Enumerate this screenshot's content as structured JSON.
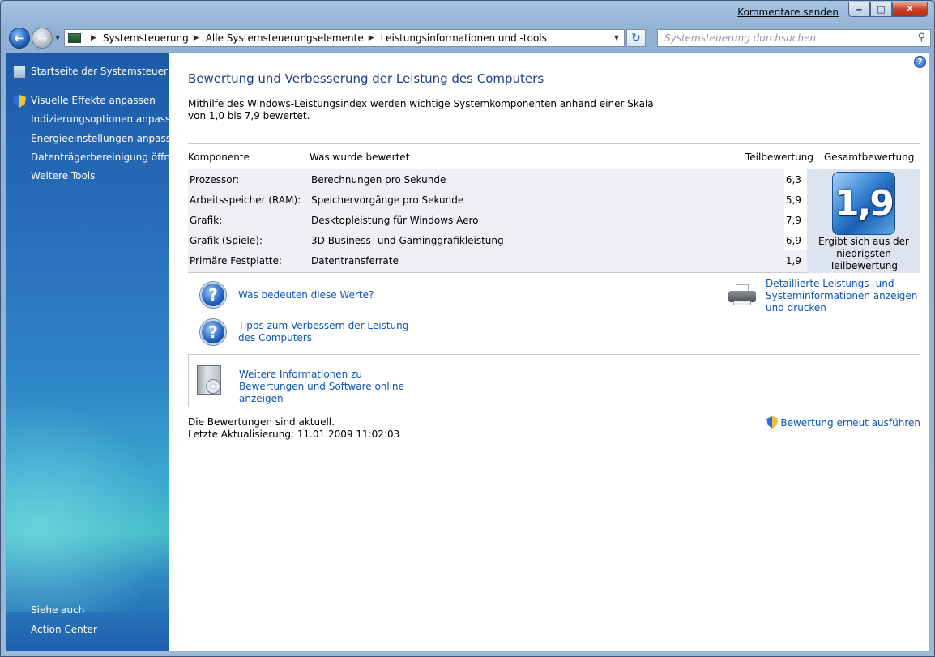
{
  "titlebar": {
    "feedback_label": "Kommentare senden",
    "minimize_icon": "minimize-icon",
    "maximize_icon": "maximize-icon",
    "close_icon": "close-icon"
  },
  "nav": {
    "back_icon": "arrow-left-icon",
    "forward_icon": "arrow-right-icon",
    "breadcrumbs": [
      "Systemsteuerung",
      "Alle Systemsteuerungselemente",
      "Leistungsinformationen und -tools"
    ],
    "search_placeholder": "Systemsteuerung durchsuchen"
  },
  "sidebar": {
    "home": "Startseite der Systemsteuerung",
    "items": [
      "Visuelle Effekte anpassen",
      "Indizierungsoptionen anpassen",
      "Energieeinstellungen anpassen",
      "Datenträgerbereinigung öffnen",
      "Weitere Tools"
    ],
    "see_also_heading": "Siehe auch",
    "see_also_items": [
      "Action Center"
    ]
  },
  "main": {
    "title": "Bewertung und Verbesserung der Leistung des Computers",
    "intro": "Mithilfe des Windows-Leistungsindex werden wichtige Systemkomponenten anhand einer Skala von 1,0 bis 7,9 bewertet.",
    "table": {
      "headers": [
        "Komponente",
        "Was wurde bewertet",
        "Teilbewertung",
        "Gesamtbewertung"
      ],
      "rows": [
        {
          "component": "Prozessor:",
          "rated": "Berechnungen pro Sekunde",
          "score": "6,3"
        },
        {
          "component": "Arbeitsspeicher (RAM):",
          "rated": "Speichervorgänge pro Sekunde",
          "score": "5,9"
        },
        {
          "component": "Grafik:",
          "rated": "Desktopleistung für Windows Aero",
          "score": "7,9"
        },
        {
          "component": "Grafik (Spiele):",
          "rated": "3D-Business- und Gaminggrafikleistung",
          "score": "6,9"
        },
        {
          "component": "Primäre Festplatte:",
          "rated": "Datentransferrate",
          "score": "1,9"
        }
      ],
      "overall_score": "1,9",
      "overall_note": "Ergibt sich aus der niedrigsten Teilbewertung"
    },
    "links": {
      "what_values": "Was bedeuten diese Werte?",
      "tips": "Tipps zum Verbessern der Leistung des Computers",
      "details": "Detaillierte Leistungs- und Systeminformationen anzeigen und drucken",
      "online": "Weitere Informationen zu Bewertungen und Software online anzeigen"
    },
    "status": {
      "current": "Die Bewertungen sind aktuell.",
      "last_update": "Letzte Aktualisierung: 11.01.2009 11:02:03",
      "rerun": "Bewertung erneut ausführen"
    }
  }
}
